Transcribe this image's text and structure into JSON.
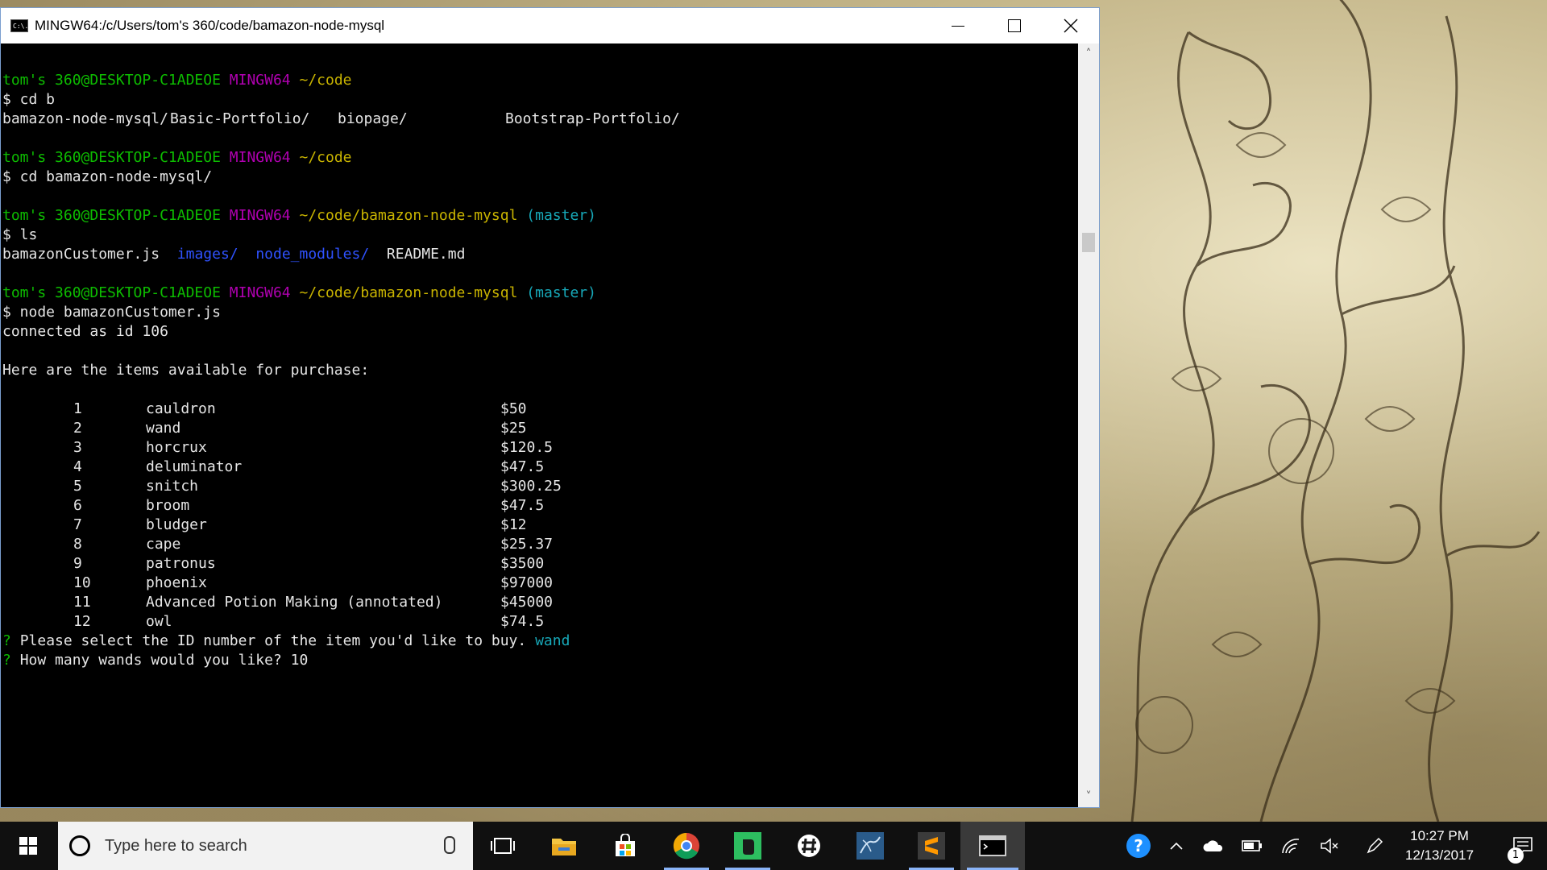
{
  "window": {
    "title": "MINGW64:/c/Users/tom's 360/code/bamazon-node-mysql",
    "app_icon_text": "C:\\."
  },
  "terminal": {
    "prompt_user": "tom's 360@DESKTOP-C1ADEOE",
    "prompt_env": "MINGW64",
    "path_code": "~/code",
    "path_project": "~/code/bamazon-node-mysql",
    "branch": "(master)",
    "cmd1": "$ cd b",
    "dirs1": [
      "bamazon-node-mysql/",
      "Basic-Portfolio/",
      "biopage/",
      "Bootstrap-Portfolio/"
    ],
    "cmd2": "$ cd bamazon-node-mysql/",
    "cmd3": "$ ls",
    "ls_file1": "bamazonCustomer.js",
    "ls_dir_images": "images/",
    "ls_dir_modules": "node_modules/",
    "ls_file2": "README.md",
    "cmd4": "$ node bamazonCustomer.js",
    "connected": "connected as id 106",
    "items_header": "Here are the items available for purchase:",
    "items": [
      {
        "id": "1",
        "name": "cauldron",
        "price": "$50"
      },
      {
        "id": "2",
        "name": "wand",
        "price": "$25"
      },
      {
        "id": "3",
        "name": "horcrux",
        "price": "$120.5"
      },
      {
        "id": "4",
        "name": "deluminator",
        "price": "$47.5"
      },
      {
        "id": "5",
        "name": "snitch",
        "price": "$300.25"
      },
      {
        "id": "6",
        "name": "broom",
        "price": "$47.5"
      },
      {
        "id": "7",
        "name": "bludger",
        "price": "$12"
      },
      {
        "id": "8",
        "name": "cape",
        "price": "$25.37"
      },
      {
        "id": "9",
        "name": "patronus",
        "price": "$3500"
      },
      {
        "id": "10",
        "name": "phoenix",
        "price": "$97000"
      },
      {
        "id": "11",
        "name": "Advanced Potion Making (annotated)",
        "price": "$45000"
      },
      {
        "id": "12",
        "name": "owl",
        "price": "$74.5"
      }
    ],
    "q1_mark": "?",
    "q1_text": "Please select the ID number of the item you'd like to buy.",
    "q1_answer": "wand",
    "q2_mark": "?",
    "q2_text": "How many wands would you like?",
    "q2_answer": "10"
  },
  "taskbar": {
    "search_placeholder": "Type here to search",
    "clock_time": "10:27 PM",
    "clock_date": "12/13/2017",
    "notification_count": "1"
  },
  "colors": {
    "prompt_green": "#0dbc00",
    "prompt_magenta": "#b000b0",
    "path_yellow": "#c9b400",
    "branch_cyan": "#17a8b8",
    "dir_blue": "#2f52ff"
  }
}
